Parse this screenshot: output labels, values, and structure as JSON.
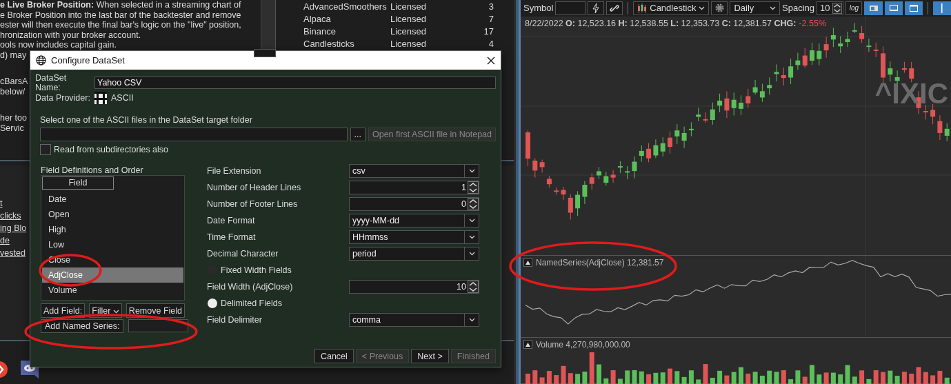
{
  "notes": {
    "paragraphs": [
      [
        "**e Live Broker Position:** When selected in a streaming chart of",
        "e Broker Position into the last bar of the backtester and remove",
        "ester will then execute the final bar's logic on the \"live\" position,",
        "hronization with your broker account.",
        "ools now includes capital gain.",
        "d) may"
      ],
      [
        "cBarsA",
        "below/"
      ],
      [
        "her too",
        "Servic"
      ]
    ],
    "links": [
      "t",
      "clicks",
      "ing Blo",
      "de",
      "vested"
    ]
  },
  "extensions_table": {
    "rows": [
      {
        "name": "AdvancedSmoothers",
        "status": "Licensed",
        "count": "3"
      },
      {
        "name": "Alpaca",
        "status": "Licensed",
        "count": "7"
      },
      {
        "name": "Binance",
        "status": "Licensed",
        "count": "17"
      },
      {
        "name": "Candlesticks",
        "status": "Licensed",
        "count": "4"
      }
    ]
  },
  "dialog": {
    "title": "Configure DataSet",
    "name_label": "DataSet Name:",
    "name_value": "Yahoo CSV",
    "provider_label": "Data Provider:",
    "provider": "ASCII",
    "file_prompt": "Select one of the ASCII files in the DataSet target folder",
    "browse_button": "...",
    "notepad_button": {
      "label": "Open first ASCII file in Notepad",
      "disabled": true
    },
    "subdirectories": {
      "label": "Read from subdirectories also",
      "checked": false
    },
    "fields_title": "Field Definitions and Order",
    "fields_header": "Field",
    "fields": [
      {
        "label": "Date",
        "selected": false
      },
      {
        "label": "Open",
        "selected": false
      },
      {
        "label": "High",
        "selected": false
      },
      {
        "label": "Low",
        "selected": false
      },
      {
        "label": "Close",
        "selected": false
      },
      {
        "label": "AdjClose",
        "selected": true
      },
      {
        "label": "Volume",
        "selected": false
      }
    ],
    "add_field_button": "Add Field:",
    "filler_dropdown": "Filler",
    "remove_field_button": "Remove Field",
    "add_named_series_button": "Add Named Series:",
    "settings": [
      {
        "kind": "dropdown",
        "label": "File Extension",
        "value": "csv"
      },
      {
        "kind": "spinner",
        "label": "Number of Header Lines",
        "value": "1"
      },
      {
        "kind": "spinner",
        "label": "Number of Footer Lines",
        "value": "0"
      },
      {
        "kind": "dropdown",
        "label": "Date Format",
        "value": "yyyy-MM-dd"
      },
      {
        "kind": "dropdown",
        "label": "Time Format",
        "value": "HHmmss"
      },
      {
        "kind": "dropdown",
        "label": "Decimal Character",
        "value": "period"
      },
      {
        "kind": "radio",
        "label": "Fixed Width Fields",
        "selected": false
      },
      {
        "kind": "spinner",
        "label": "Field Width (AdjClose)",
        "value": "10"
      },
      {
        "kind": "radio",
        "label": "Delimited Fields",
        "selected": true
      },
      {
        "kind": "dropdown",
        "label": "Field Delimiter",
        "value": "comma"
      }
    ],
    "buttons": [
      {
        "label": "Cancel",
        "disabled": false
      },
      {
        "label": "< Previous",
        "disabled": true
      },
      {
        "label": "Next >",
        "disabled": false
      },
      {
        "label": "Finished",
        "disabled": true
      }
    ]
  },
  "chart": {
    "toolbar": {
      "symbol_label": "Symbol",
      "chart_style": "Candlestick",
      "scale": "Daily",
      "spacing_label": "Spacing",
      "spacing": "10",
      "log_toggle": {
        "label": "log",
        "on": false
      },
      "view_toggles": [
        {
          "on": true
        },
        {
          "on": true
        },
        {
          "on": true
        },
        {
          "on": true
        }
      ]
    },
    "summary": "8/22/2022 **O:** 12,523.16 **H:** 12,538.55 **L:** 12,353.73 **C:** 12,381.57 **CHG:**",
    "change": "-2.55%",
    "watermark": "^IXIC",
    "panes": [
      {
        "label": "NamedSeries(AdjClose) 12,381.57"
      },
      {
        "label": "Volume 4,270,980,000.00"
      }
    ]
  }
}
